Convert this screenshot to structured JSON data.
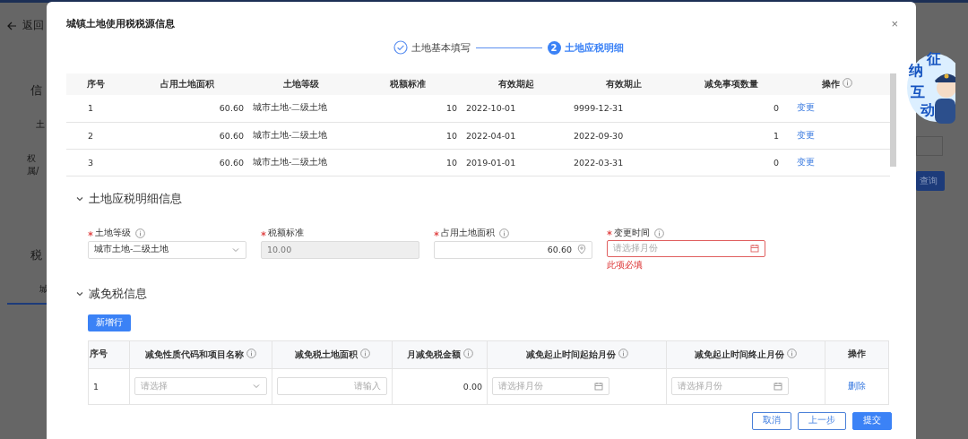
{
  "background": {
    "back_link": "返回",
    "section_1": "信",
    "field_1": "土",
    "field_2": "权属/",
    "section_2": "税",
    "tab": "城",
    "query_button": "查询"
  },
  "mascot": {
    "characters": [
      "征",
      "纳",
      "互",
      "动"
    ]
  },
  "dialog": {
    "title": "城镇土地使用税税源信息",
    "close": "×",
    "steps": [
      {
        "label": "土地基本填写",
        "completed": true,
        "selected": false
      },
      {
        "label": "土地应税明细",
        "completed": false,
        "selected": true,
        "number": "2"
      }
    ],
    "records": {
      "columns": [
        {
          "label": "序号",
          "info": false
        },
        {
          "label": "占用土地面积",
          "info": false
        },
        {
          "label": "土地等级",
          "info": false
        },
        {
          "label": "税额标准",
          "info": false
        },
        {
          "label": "有效期起",
          "info": false
        },
        {
          "label": "有效期止",
          "info": false
        },
        {
          "label": "减免事项数量",
          "info": false
        },
        {
          "label": "操作",
          "info": true
        }
      ],
      "rows": [
        {
          "cells": [
            "1",
            "60.60",
            "城市土地-二级土地",
            "10",
            "2022-10-01",
            "9999-12-31",
            "0"
          ],
          "action": "变更"
        },
        {
          "cells": [
            "2",
            "60.60",
            "城市土地-二级土地",
            "10",
            "2022-04-01",
            "2022-09-30",
            "1"
          ],
          "action": "变更"
        },
        {
          "cells": [
            "3",
            "60.60",
            "城市土地-二级土地",
            "10",
            "2019-01-01",
            "2022-03-31",
            "0"
          ],
          "action": "变更"
        }
      ]
    },
    "detail": {
      "title": "土地应税明细信息",
      "expanded": true,
      "fields": [
        {
          "kind": "select",
          "label": "土地等级",
          "required": true,
          "info": true,
          "value": "城市土地-二级土地"
        },
        {
          "kind": "disabled",
          "label": "税额标准",
          "required": true,
          "info": false,
          "value": "10.00"
        },
        {
          "kind": "number",
          "label": "占用土地面积",
          "required": true,
          "info": true,
          "value": "60.60"
        },
        {
          "kind": "month",
          "label": "变更时间",
          "required": true,
          "info": true,
          "placeholder": "请选择月份",
          "error": "此项必填"
        }
      ]
    },
    "exemption": {
      "title": "减免税信息",
      "expanded": true,
      "add_button": "新增行",
      "columns": [
        {
          "label": "序号",
          "info": false
        },
        {
          "label": "减免性质代码和项目名称",
          "info": true
        },
        {
          "label": "减免税土地面积",
          "info": true
        },
        {
          "label": "月减免税金额",
          "info": true
        },
        {
          "label": "减免起止时间起始月份",
          "info": true
        },
        {
          "label": "减免起止时间终止月份",
          "info": true
        },
        {
          "label": "操作",
          "info": false
        }
      ],
      "rows": [
        {
          "index": "1",
          "nature_placeholder": "请选择",
          "area_placeholder": "请输入",
          "amount": "0.00",
          "start_placeholder": "请选择月份",
          "end_placeholder": "请选择月份",
          "action": "删除"
        }
      ]
    },
    "buttons": [
      {
        "label": "取消",
        "primary": false
      },
      {
        "label": "上一步",
        "primary": false
      },
      {
        "label": "提交",
        "primary": true
      }
    ]
  }
}
